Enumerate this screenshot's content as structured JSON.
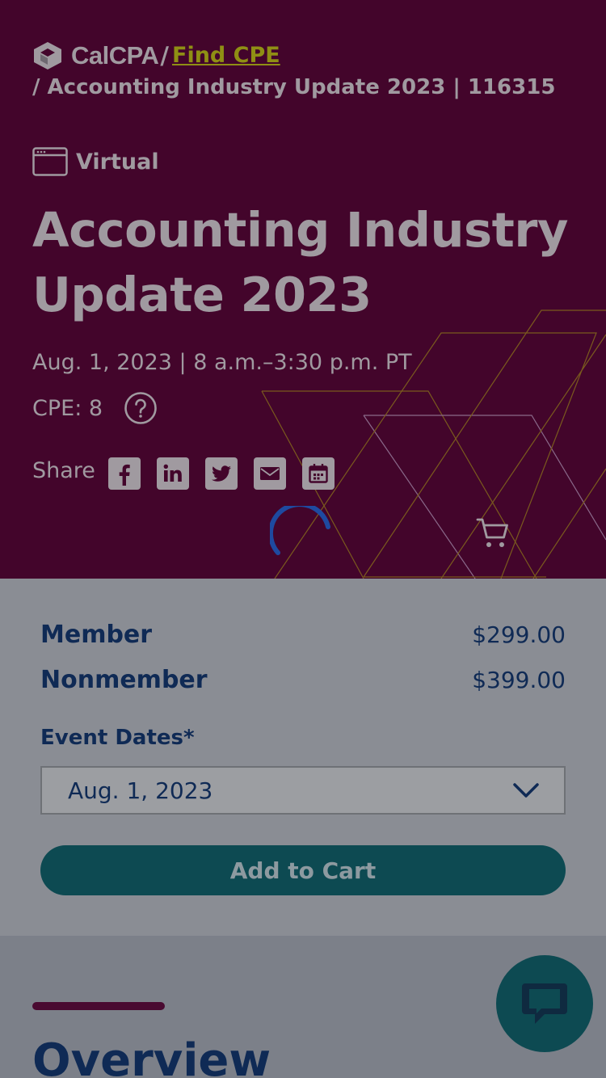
{
  "breadcrumb": {
    "logo_text": "CalCPA",
    "separator": "/",
    "link": "Find CPE",
    "current": "/ Accounting Industry Update 2023 | 116315"
  },
  "event": {
    "format": "Virtual",
    "title": "Accounting Industry Update 2023",
    "datetime": "Aug. 1, 2023 | 8 a.m.–3:30 p.m. PT",
    "cpe": "CPE: 8",
    "share_label": "Share",
    "share_icons": [
      "facebook-icon",
      "linkedin-icon",
      "twitter-icon",
      "email-icon",
      "calendar-icon"
    ]
  },
  "pricing": {
    "member_label": "Member",
    "member_price": "$299.00",
    "nonmember_label": "Nonmember",
    "nonmember_price": "$399.00"
  },
  "event_dates": {
    "label": "Event Dates*",
    "selected": "Aug. 1, 2023"
  },
  "add_to_cart": "Add to Cart",
  "overview": {
    "title": "Overview"
  },
  "colors": {
    "hero_bg": "#43052b",
    "link": "#8f8f14",
    "navy": "#0f2a55",
    "teal": "#0d4a52",
    "spinner": "#1e4aa0"
  }
}
